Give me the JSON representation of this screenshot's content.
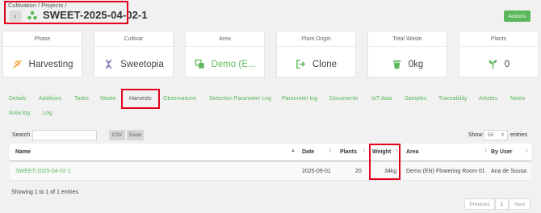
{
  "header": {
    "breadcrumb": "Cultivation / Projects /",
    "title": "SWEET-2025-04-02-1",
    "actions_label": "Actions"
  },
  "cards": [
    {
      "label": "Phase",
      "value": "Harvesting",
      "icon": "harvest-icon"
    },
    {
      "label": "Cultivar",
      "value": "Sweetopia",
      "icon": "dna-icon"
    },
    {
      "label": "Area",
      "value": "Demo (E...",
      "icon": "area-icon"
    },
    {
      "label": "Plant Origin",
      "value": "Clone",
      "icon": "clone-icon"
    },
    {
      "label": "Total Waste",
      "value": "0kg",
      "icon": "trash-icon"
    },
    {
      "label": "Plants",
      "value": "0",
      "icon": "seedling-icon"
    }
  ],
  "tabs": [
    "Details",
    "Additives",
    "Tasks",
    "Waste",
    "Harvests",
    "Observations",
    "Selection Parameter Log",
    "Parameter log",
    "Documents",
    "IoT data",
    "Samples",
    "Traceability",
    "Articles",
    "Notes",
    "Area log",
    "Log"
  ],
  "active_tab": "Harvests",
  "controls": {
    "search_label": "Search",
    "csv_label": "CSV",
    "excel_label": "Excel",
    "show_label": "Show",
    "page_size": "50",
    "entries_label": "entries"
  },
  "table": {
    "columns": [
      "Name",
      "Date",
      "Plants",
      "Weight",
      "Area",
      "By User"
    ],
    "rows": [
      {
        "name": "SWEET-2025-04-02-1",
        "date": "2025-09-01",
        "plants": "20",
        "weight": "34kg",
        "area": "Demo (EN) Flowering Room 01",
        "user": "Ana de Sousa"
      }
    ]
  },
  "footer": {
    "info": "Showing 1 to 1 of 1 entries",
    "previous": "Previous",
    "page": "1",
    "next": "Next"
  },
  "colors": {
    "accent": "#5cb85c",
    "highlight": "#e3001b"
  }
}
